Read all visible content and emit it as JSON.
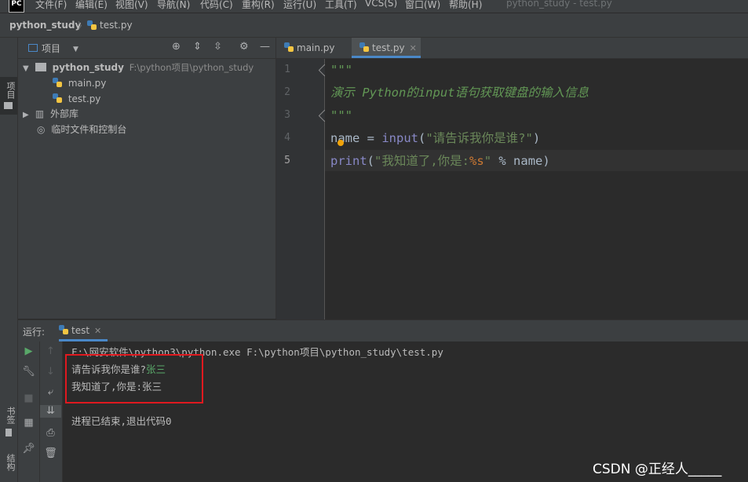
{
  "menubar": {
    "logo": "PC",
    "items": [
      "文件(F)",
      "编辑(E)",
      "视图(V)",
      "导航(N)",
      "代码(C)",
      "重构(R)",
      "运行(U)",
      "工具(T)",
      "VCS(S)",
      "窗口(W)",
      "帮助(H)"
    ],
    "window_title": "python_study - test.py"
  },
  "breadcrumb": {
    "project": "python_study",
    "file": "test.py"
  },
  "left_stripe": {
    "project": "项目",
    "bookmarks": "书签",
    "structure": "结构"
  },
  "project_panel": {
    "title": "项目",
    "tree": {
      "root_name": "python_study",
      "root_path": "F:\\python项目\\python_study",
      "files": [
        "main.py",
        "test.py"
      ],
      "external_libs": "外部库",
      "scratches": "临时文件和控制台"
    }
  },
  "editor": {
    "tabs": [
      "main.py",
      "test.py"
    ],
    "active_tab": "test.py",
    "line_numbers": [
      "1",
      "2",
      "3",
      "4",
      "5"
    ],
    "code": {
      "l1": "\"\"\"",
      "l2": "演示 Python的input语句获取键盘的输入信息",
      "l3": "\"\"\"",
      "l4_var": "name",
      "l4_op": " = ",
      "l4_fn": "input",
      "l4_paren_open": "(",
      "l4_str": "\"请告诉我你是谁?\"",
      "l4_paren_close": ")",
      "l5_fn": "print",
      "l5_paren_open": "(",
      "l5_str_a": "\"我知道了,你是:",
      "l5_fmt": "%s",
      "l5_str_b": "\"",
      "l5_rest": " % name",
      "l5_paren_close": ")"
    }
  },
  "run_panel": {
    "label": "运行:",
    "tab": "test",
    "console": {
      "command": "F:\\网安软件\\python3\\python.exe F:\\python项目\\python_study\\test.py",
      "prompt": "请告诉我你是谁?",
      "user_input": "张三",
      "output": "我知道了,你是:张三",
      "exit": "进程已结束,退出代码0"
    }
  },
  "watermark": "CSDN @正经人_____",
  "colors": {
    "accent": "#4a88c7",
    "highlight_box": "#e0191f",
    "docstring": "#629755",
    "string": "#6a8759",
    "builtin": "#8888c6"
  }
}
